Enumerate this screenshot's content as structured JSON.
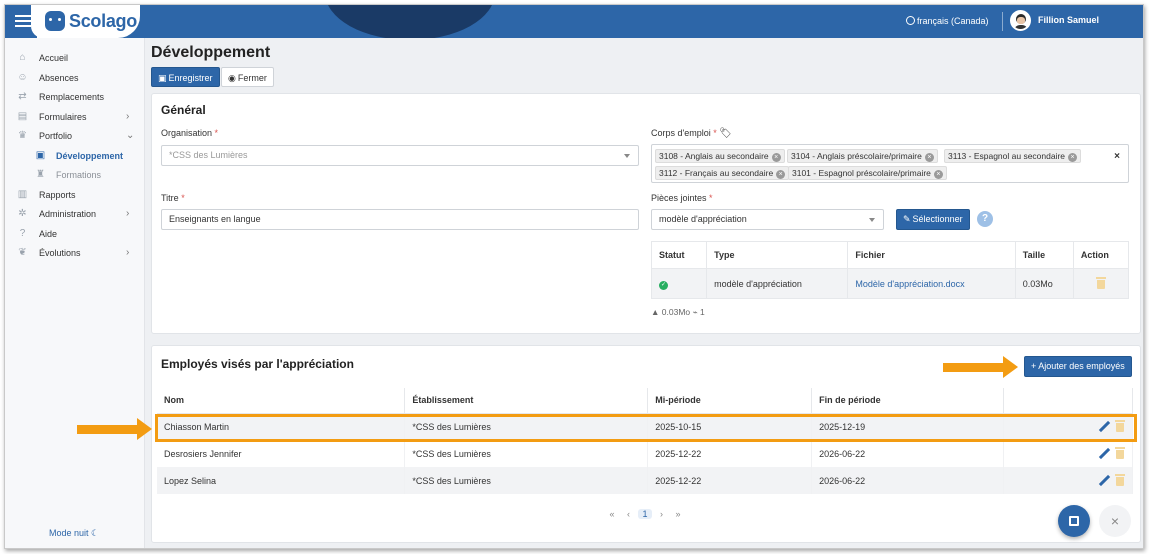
{
  "app": {
    "logo": "Scolago",
    "language": "français (Canada)",
    "user": "Fillion Samuel"
  },
  "sidebar": {
    "items": [
      {
        "label": "Accueil",
        "icon": "home-icon"
      },
      {
        "label": "Absences",
        "icon": "user-absence-icon"
      },
      {
        "label": "Remplacements",
        "icon": "replacement-icon"
      },
      {
        "label": "Formulaires",
        "icon": "form-icon",
        "chevron": "›"
      },
      {
        "label": "Portfolio",
        "icon": "trophy-icon",
        "chevron": "⌄"
      },
      {
        "label": "Développement",
        "icon": "development-icon",
        "sub": true,
        "active": true
      },
      {
        "label": "Formations",
        "icon": "graduation-icon",
        "sub": true
      },
      {
        "label": "Rapports",
        "icon": "report-icon"
      },
      {
        "label": "Administration",
        "icon": "gear-icon",
        "chevron": "›"
      },
      {
        "label": "Aide",
        "icon": "help-icon"
      },
      {
        "label": "Évolutions",
        "icon": "sprout-icon",
        "chevron": "›"
      }
    ],
    "night_mode": "Mode nuit ☾"
  },
  "page": {
    "title": "Développement",
    "save_label": "Enregistrer",
    "close_label": "Fermer"
  },
  "general": {
    "title": "Général",
    "organisation": {
      "label": "Organisation",
      "required": "*",
      "placeholder": "*CSS des Lumières"
    },
    "corps_emploi": {
      "label": "Corps d'emploi",
      "required": "*",
      "tags": [
        "3108 - Anglais au secondaire",
        "3104 - Anglais préscolaire/primaire",
        "3113 - Espagnol au secondaire",
        "3112 - Français au secondaire",
        "3101 - Espagnol préscolaire/primaire"
      ],
      "clear": "×"
    },
    "titre": {
      "label": "Titre",
      "required": "*",
      "value": "Enseignants en langue"
    },
    "pieces": {
      "label": "Pièces jointes",
      "required": "*",
      "selected": "modèle d'appréciation",
      "select_button": "Sélectionner",
      "help": "?"
    },
    "attachments": {
      "headers": [
        "Statut",
        "Type",
        "Fichier",
        "Taille",
        "Action"
      ],
      "rows": [
        {
          "type": "modèle d'appréciation",
          "file": "Modèle d'appréciation.docx",
          "size": "0.03Mo"
        }
      ],
      "meta_size": "0.03Mo",
      "meta_count": "1"
    }
  },
  "employees": {
    "title": "Employés visés par l'appréciation",
    "add_button": "Ajouter des employés",
    "headers": [
      "Nom",
      "Établissement",
      "Mi-période",
      "Fin de période",
      ""
    ],
    "rows": [
      {
        "name": "Chiasson Martin",
        "etab": "*CSS des Lumières",
        "mid": "2025-10-15",
        "end": "2025-12-19"
      },
      {
        "name": "Desrosiers Jennifer",
        "etab": "*CSS des Lumières",
        "mid": "2025-12-22",
        "end": "2026-06-22"
      },
      {
        "name": "Lopez Selina",
        "etab": "*CSS des Lumières",
        "mid": "2025-12-22",
        "end": "2026-06-22"
      }
    ],
    "pager": {
      "first": "«",
      "prev": "‹",
      "current": "1",
      "next": "›",
      "last": "»"
    }
  },
  "colors": {
    "brand": "#2d66a8",
    "highlight": "#f39c12",
    "success": "#27ae60"
  }
}
